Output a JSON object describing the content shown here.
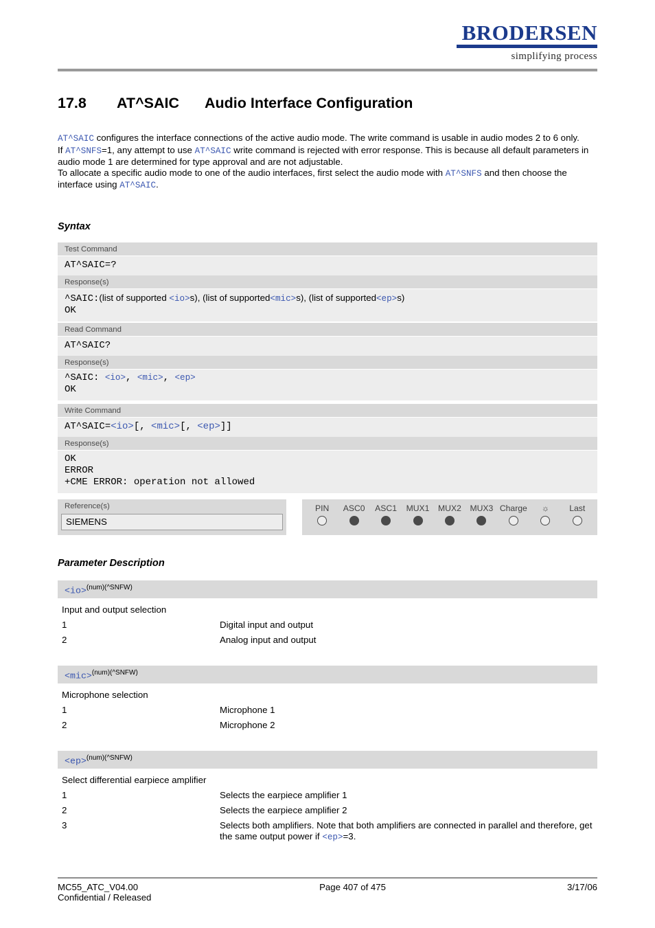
{
  "header": {
    "logo_name": "BRODERSEN",
    "logo_tagline": "simplifying process"
  },
  "title": {
    "number": "17.8",
    "command": "AT^SAIC",
    "text": "Audio Interface Configuration"
  },
  "intro": {
    "line1_a": "AT^SAIC",
    "line1_b": " configures the interface connections of the active audio mode. The write command is usable in audio modes 2 to 6 only.",
    "line2_a": "If ",
    "line2_b": "AT^SNFS",
    "line2_c": "=1, any attempt to use ",
    "line2_d": "AT^SAIC",
    "line2_e": " write command is rejected with error response. This is because all default parameters in audio mode 1 are determined for type approval and are not adjustable.",
    "line3_a": "To allocate a specific audio mode to one of the audio interfaces, first select the audio mode with ",
    "line3_b": "AT^SNFS",
    "line3_c": " and then choose the interface using ",
    "line3_d": "AT^SAIC",
    "line3_e": "."
  },
  "headings": {
    "syntax": "Syntax",
    "parameter_description": "Parameter Description"
  },
  "syntax": {
    "test": {
      "band": "Test Command",
      "command": "AT^SAIC=?",
      "response_band": "Response(s)",
      "resp_line1_a": "^SAIC:",
      "resp_line1_b": "(list of supported ",
      "resp_line1_io": "<io>",
      "resp_line1_c": "s), (list of supported",
      "resp_line1_mic": "<mic>",
      "resp_line1_d": "s), (list of supported",
      "resp_line1_ep": "<ep>",
      "resp_line1_e": "s)",
      "resp_line2": "OK"
    },
    "read": {
      "band": "Read Command",
      "command": "AT^SAIC?",
      "response_band": "Response(s)",
      "resp_line1_a": "^SAIC: ",
      "resp_io": "<io>",
      "resp_sep1": ", ",
      "resp_mic": "<mic>",
      "resp_sep2": ", ",
      "resp_ep": "<ep>",
      "resp_line2": "OK"
    },
    "write": {
      "band": "Write Command",
      "cmd_a": "AT^SAIC=",
      "cmd_io": "<io>",
      "cmd_b": "[, ",
      "cmd_mic": "<mic>",
      "cmd_c": "[, ",
      "cmd_ep": "<ep>",
      "cmd_d": "]]",
      "response_band": "Response(s)",
      "resp_line1": "OK",
      "resp_line2": "ERROR",
      "resp_line3": "+CME ERROR: operation not allowed"
    },
    "reference": {
      "band": "Reference(s)",
      "value": "SIEMENS"
    },
    "pins": {
      "columns": [
        "PIN",
        "ASC0",
        "ASC1",
        "MUX1",
        "MUX2",
        "MUX3",
        "Charge",
        "☼",
        "Last"
      ],
      "states": [
        false,
        true,
        true,
        true,
        true,
        true,
        false,
        false,
        false
      ]
    }
  },
  "parameters": [
    {
      "name": "<io>",
      "type": "(num)(^SNFW)",
      "description": "Input and output selection",
      "rows": [
        {
          "key": "1",
          "value": "Digital input and output"
        },
        {
          "key": "2",
          "value": "Analog input and output"
        }
      ]
    },
    {
      "name": "<mic>",
      "type": "(num)(^SNFW)",
      "description": "Microphone selection",
      "rows": [
        {
          "key": "1",
          "value": "Microphone 1"
        },
        {
          "key": "2",
          "value": "Microphone 2"
        }
      ]
    },
    {
      "name": "<ep>",
      "type": "(num)(^SNFW)",
      "description": "Select differential earpiece amplifier",
      "rows": [
        {
          "key": "1",
          "value": "Selects the earpiece amplifier 1"
        },
        {
          "key": "2",
          "value": "Selects the earpiece amplifier 2"
        },
        {
          "key": "3",
          "value": "Selects both amplifiers. Note that both amplifiers are connected in parallel and therefore, get the same output power if "
        }
      ],
      "row3_ep": "<ep>",
      "row3_tail": "=3."
    }
  ],
  "footer": {
    "left_line1": "MC55_ATC_V04.00",
    "left_line2": "Confidential / Released",
    "center": "Page 407 of 475",
    "right": "3/17/06"
  }
}
